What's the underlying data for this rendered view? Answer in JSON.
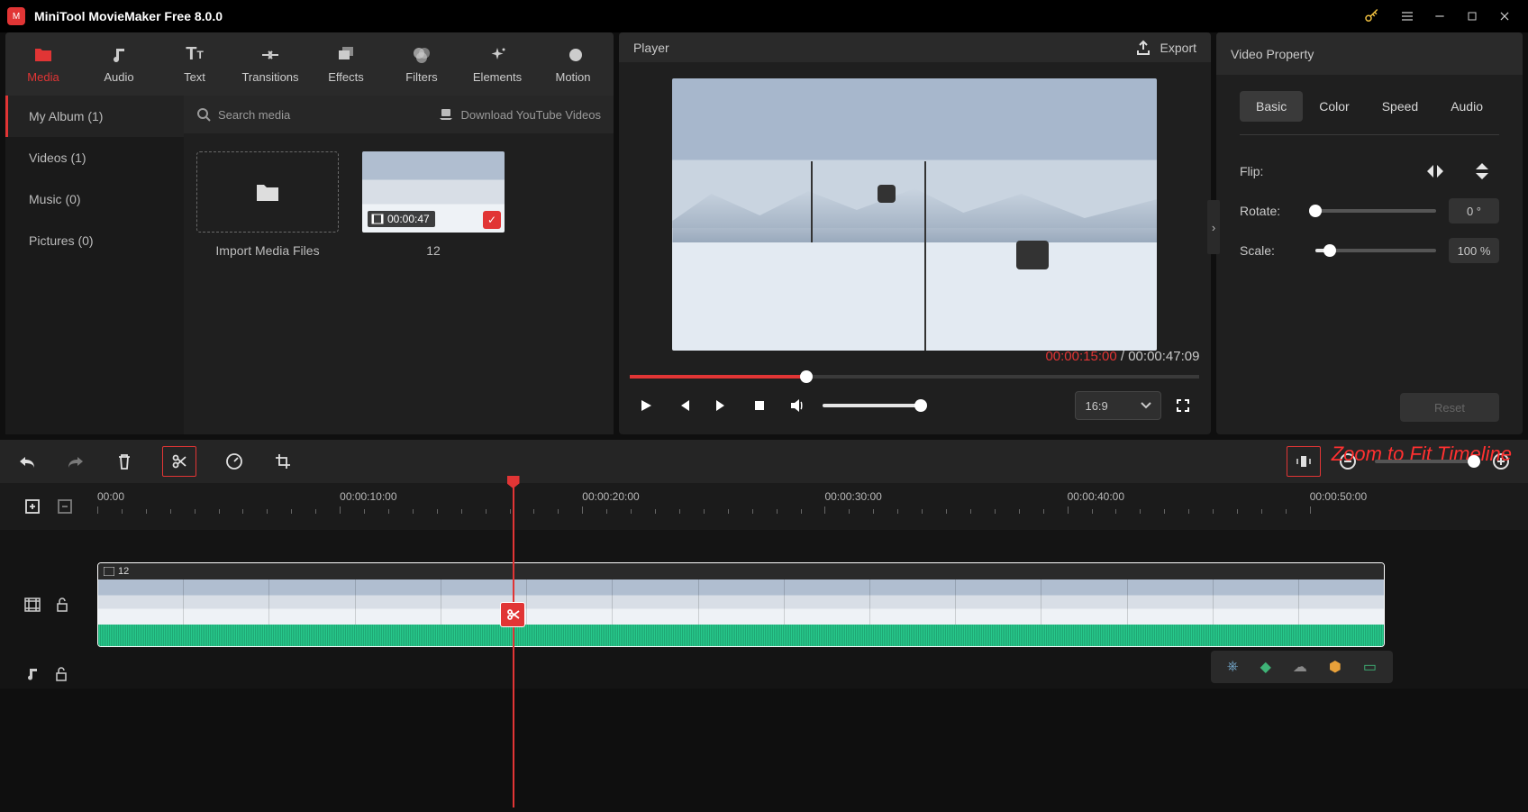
{
  "app": {
    "title": "MiniTool MovieMaker Free 8.0.0"
  },
  "modeTabs": [
    {
      "label": "Media"
    },
    {
      "label": "Audio"
    },
    {
      "label": "Text"
    },
    {
      "label": "Transitions"
    },
    {
      "label": "Effects"
    },
    {
      "label": "Filters"
    },
    {
      "label": "Elements"
    },
    {
      "label": "Motion"
    }
  ],
  "albums": [
    {
      "label": "My Album (1)"
    },
    {
      "label": "Videos (1)"
    },
    {
      "label": "Music (0)"
    },
    {
      "label": "Pictures (0)"
    }
  ],
  "search": {
    "placeholder": "Search media"
  },
  "downloadYT": "Download YouTube Videos",
  "importLabel": "Import Media Files",
  "clip1": {
    "duration": "00:00:47",
    "name": "12"
  },
  "player": {
    "title": "Player",
    "exportLabel": "Export",
    "current": "00:00:15:00",
    "total": "00:00:47:09",
    "progressPct": 31,
    "ratio": "16:9"
  },
  "property": {
    "title": "Video Property",
    "tabs": [
      "Basic",
      "Color",
      "Speed",
      "Audio"
    ],
    "flipLabel": "Flip:",
    "rotateLabel": "Rotate:",
    "rotateValue": "0 °",
    "rotatePct": 0,
    "scaleLabel": "Scale:",
    "scaleValue": "100 %",
    "scalePct": 12,
    "resetLabel": "Reset"
  },
  "annotation": "Zoom to Fit Timeline",
  "ruler": {
    "labels": [
      "00:00",
      "00:00:10:00",
      "00:00:20:00",
      "00:00:30:00",
      "00:00:40:00",
      "00:00:50:00"
    ]
  },
  "timelineClip": {
    "name": "12",
    "durationPct": 90
  },
  "playheadPct": 29
}
